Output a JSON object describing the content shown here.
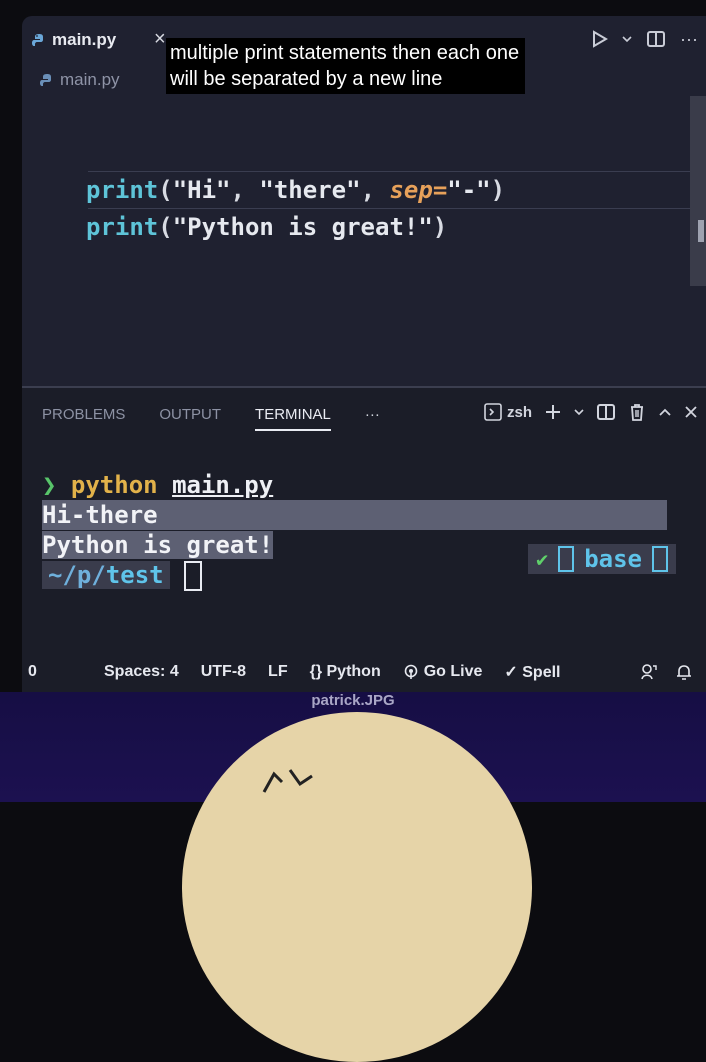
{
  "editor": {
    "tab_label": "main.py",
    "tab_close": "×",
    "breadcrumb": "main.py",
    "toolbar_icons": [
      "run-icon",
      "chevron-down-icon",
      "split-editor-icon",
      "more-icon"
    ],
    "code": {
      "line1": {
        "fn": "print",
        "open": "(",
        "s1": "\"Hi\"",
        "c1": ", ",
        "s2": "\"there\"",
        "c2": ", ",
        "kw": "sep",
        "eq": "=",
        "s3": "\"-\"",
        "close": ")"
      },
      "line2": {
        "fn": "print",
        "open": "(",
        "s1": "\"Python is great!\"",
        "close": ")"
      }
    }
  },
  "caption": {
    "line1": "multiple print statements then each one",
    "line2": "will be separated by a new line"
  },
  "panel": {
    "tabs": [
      "PROBLEMS",
      "OUTPUT",
      "TERMINAL"
    ],
    "active_tab": "TERMINAL",
    "more": "···",
    "shell": "zsh",
    "actions": [
      "new-terminal-icon",
      "chevron-down-icon",
      "split-terminal-icon",
      "trash-icon",
      "maximize-icon",
      "close-icon"
    ]
  },
  "terminal": {
    "prompt_symbol": "❯",
    "command": "python",
    "command_arg": "main.py",
    "output": [
      "Hi-there",
      "Python is great!"
    ],
    "cwd_prefix": "~/p/",
    "cwd_dir": "test",
    "status_check": "✔",
    "env": "base"
  },
  "statusbar": {
    "left": "0",
    "items": [
      "Spaces: 4",
      "UTF-8",
      "LF",
      "{} Python",
      "Go Live",
      "✓ Spell"
    ],
    "icons": [
      "feedback-icon",
      "bell-icon"
    ]
  },
  "webcam": {
    "label": "patrick.JPG"
  },
  "colors": {
    "editor_bg": "#1f2130",
    "keyword": "#5ec4d8",
    "param": "#e7a15a",
    "prompt_green": "#58c46a",
    "command_yellow": "#e2b24a"
  }
}
